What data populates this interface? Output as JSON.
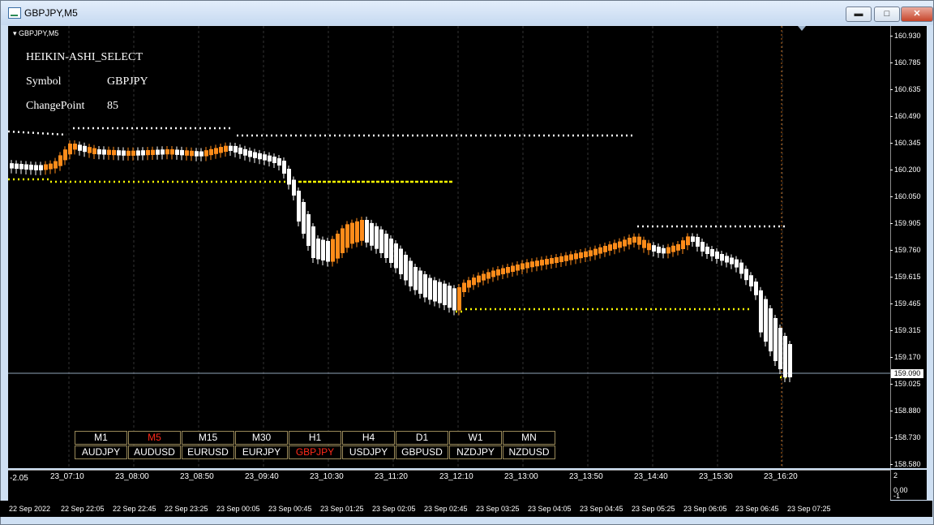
{
  "window": {
    "title": "GBPJPY,M5",
    "minimize": "▬",
    "maximize": "□",
    "close": "✕"
  },
  "chart": {
    "symbol_label": "GBPJPY,M5",
    "indicator_name": "HEIKIN-ASHI_SELECT",
    "symbol_key": "Symbol",
    "symbol_value": "GBPJPY",
    "changepoint_key": "ChangePoint",
    "changepoint_value": "85",
    "current_price": "159.090",
    "colors": {
      "bull": "#ff8c1a",
      "bear": "#ffffff",
      "support": "#ffff00",
      "resistance": "#ffffff",
      "background": "#000000"
    },
    "price_ticks": [
      "160.930",
      "160.785",
      "160.635",
      "160.490",
      "160.345",
      "160.200",
      "160.050",
      "159.905",
      "159.760",
      "159.615",
      "159.465",
      "159.315",
      "159.170",
      "159.025",
      "158.880",
      "158.730",
      "158.580"
    ],
    "inner_time_labels": [
      "23_07:10",
      "23_08:00",
      "23_08:50",
      "23_09:40",
      "23_10:30",
      "23_11:20",
      "23_12:10",
      "23_13:00",
      "23_13:50",
      "23_14:40",
      "23_15:30",
      "23_16:20"
    ],
    "sub_panel_label": "-2.05",
    "sub_ticks": [
      "2",
      "0.00",
      "-1"
    ]
  },
  "timeframes": [
    "M1",
    "M5",
    "M15",
    "M30",
    "H1",
    "H4",
    "D1",
    "W1",
    "MN"
  ],
  "active_timeframe": "M5",
  "symbols": [
    "AUDJPY",
    "AUDUSD",
    "EURUSD",
    "EURJPY",
    "GBPJPY",
    "USDJPY",
    "GBPUSD",
    "NZDJPY",
    "NZDUSD"
  ],
  "active_symbol": "GBPJPY",
  "time_axis": [
    "22 Sep 2022",
    "22 Sep 22:05",
    "22 Sep 22:45",
    "22 Sep 23:25",
    "23 Sep 00:05",
    "23 Sep 00:45",
    "23 Sep 01:25",
    "23 Sep 02:05",
    "23 Sep 02:45",
    "23 Sep 03:25",
    "23 Sep 04:05",
    "23 Sep 04:45",
    "23 Sep 05:25",
    "23 Sep 06:05",
    "23 Sep 06:45",
    "23 Sep 07:25"
  ]
}
